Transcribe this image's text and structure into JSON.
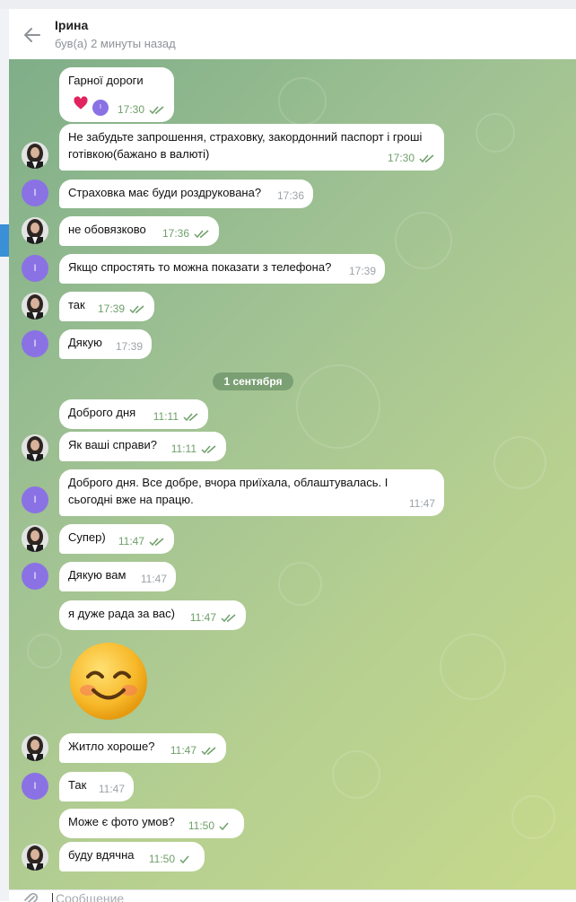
{
  "header": {
    "title": "Ірина",
    "status": "був(а) 2 минуты назад"
  },
  "date_separator": "1 сентября",
  "input": {
    "placeholder": "Сообщение"
  },
  "colors": {
    "accent": "#3a8fd6",
    "avatar_initials_bg": "#8a72e5",
    "read_check": "#6fa06a"
  },
  "messages": [
    {
      "sender": "Ірина",
      "text": "Гарної дороги",
      "time": "17:30",
      "reaction": "❤️",
      "reaction_avatar": "I"
    },
    {
      "sender": "Ірина",
      "text": "Не забудьте запрошення, страховку, закордонний паспорт і гроші готівкою(бажано в валюті)",
      "time": "17:30"
    },
    {
      "sender": "I",
      "text": "Страховка має буди роздрукована?",
      "time": "17:36"
    },
    {
      "sender": "Ірина",
      "text": "не обовязково",
      "time": "17:36"
    },
    {
      "sender": "I",
      "text": "Якщо спростять то можна показати з телефона?",
      "time": "17:39"
    },
    {
      "sender": "Ірина",
      "text": "так",
      "time": "17:39"
    },
    {
      "sender": "I",
      "text": "Дякую",
      "time": "17:39"
    },
    {
      "sender": "Ірина",
      "text": "Доброго дня",
      "time": "11:11"
    },
    {
      "sender": "Ірина",
      "text": "Як ваші справи?",
      "time": "11:11"
    },
    {
      "sender": "I",
      "text": "Доброго дня. Все добре, вчора приїхала, облаштувалась. І сьогодні вже на працю.",
      "time": "11:47"
    },
    {
      "sender": "Ірина",
      "text": "Супер)",
      "time": "11:47"
    },
    {
      "sender": "I",
      "text": "Дякую вам",
      "time": "11:47"
    },
    {
      "sender": "Ірина",
      "text": "я дуже рада за вас)",
      "time": "11:47"
    },
    {
      "sender": "Ірина",
      "text": "Житло хороше?",
      "time": "11:47"
    },
    {
      "sender": "I",
      "text": "Так",
      "time": "11:47"
    },
    {
      "sender": "Ірина",
      "text": "Може є фото умов?",
      "time": "11:50"
    },
    {
      "sender": "Ірина",
      "text": "буду вдячна",
      "time": "11:50"
    }
  ]
}
